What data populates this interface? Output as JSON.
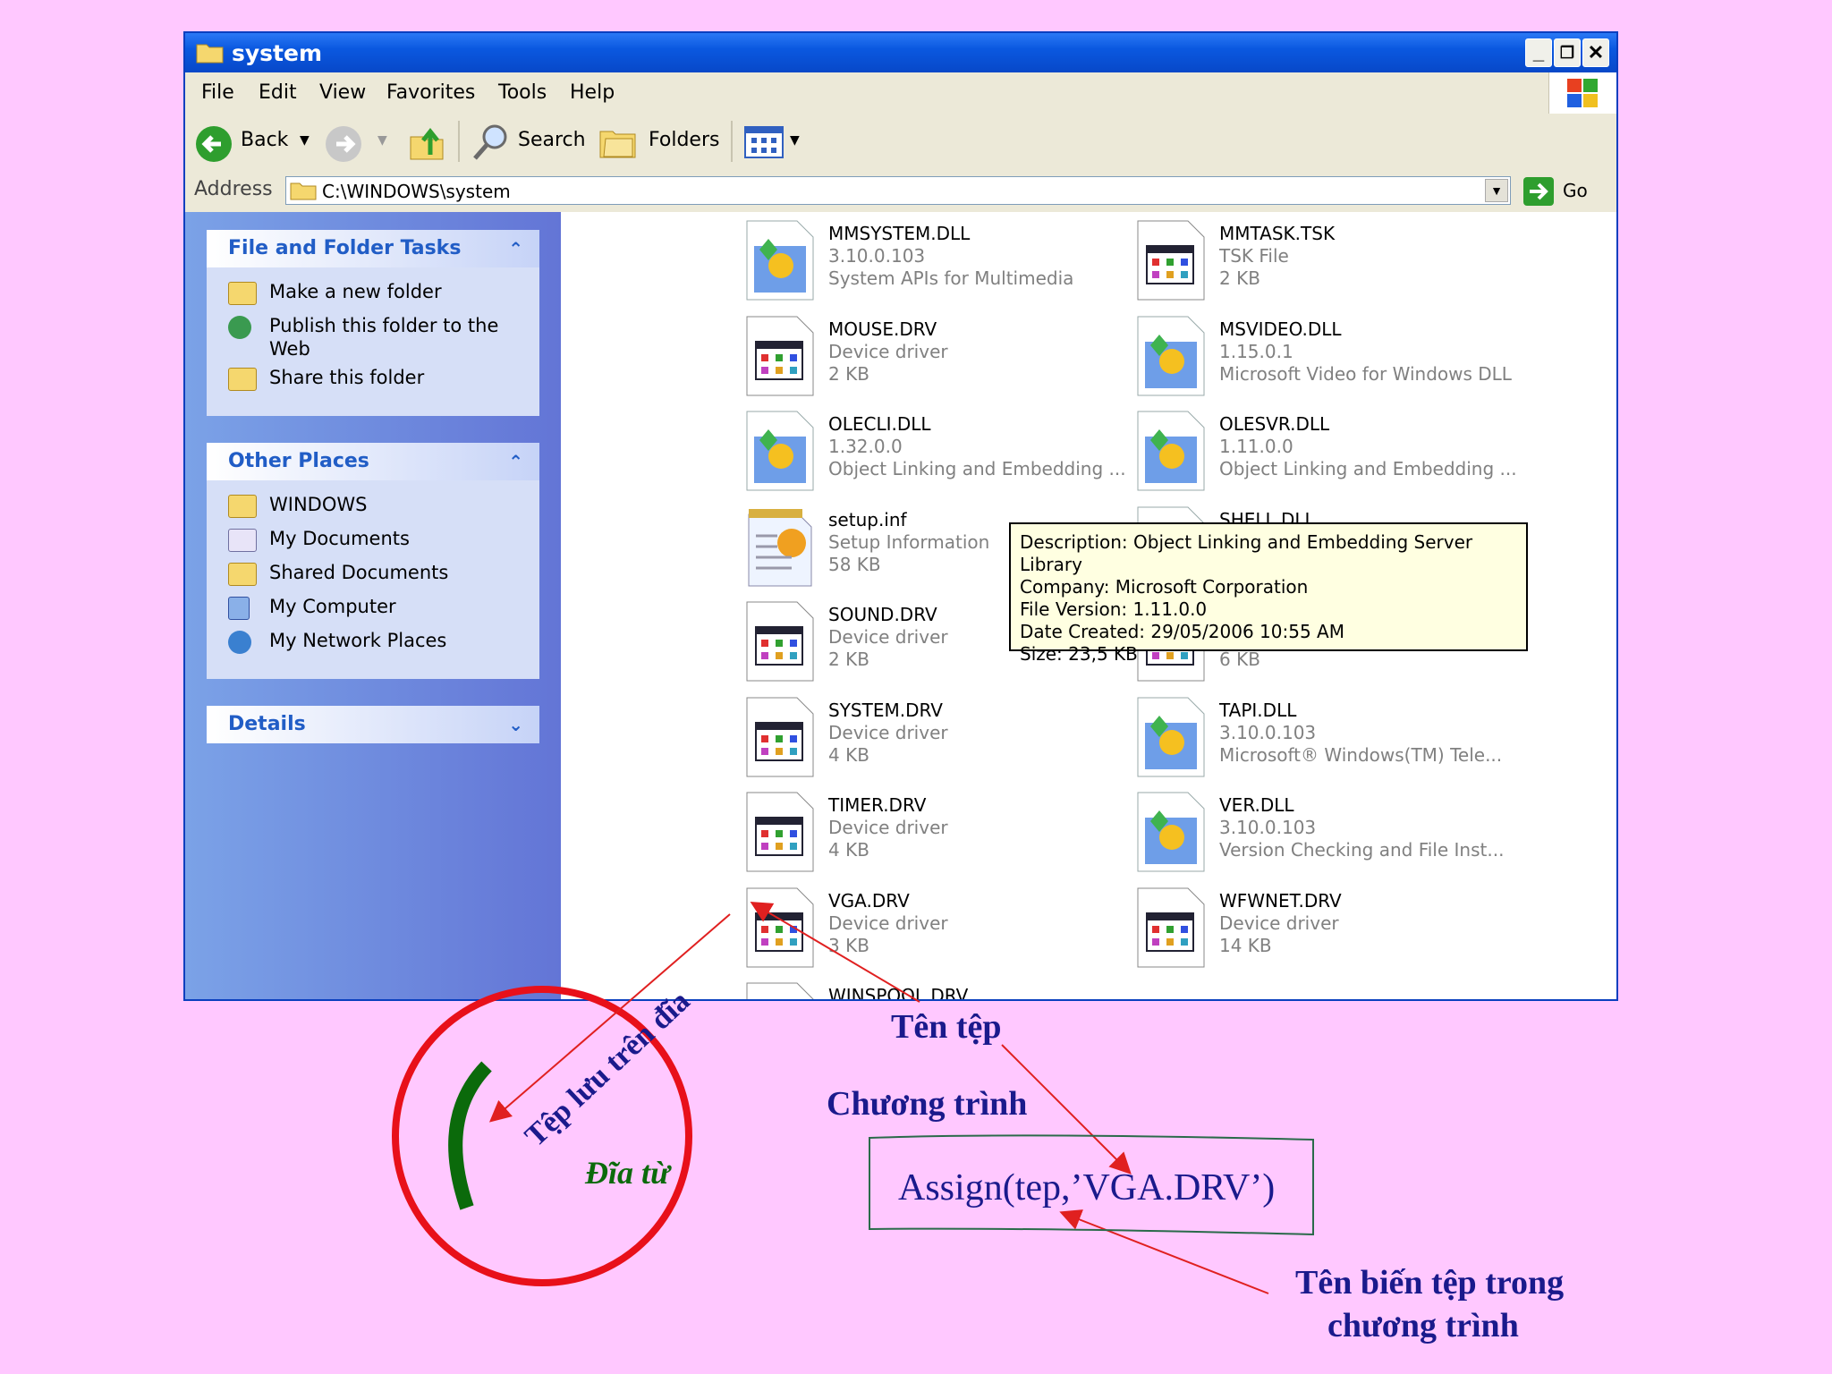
{
  "window": {
    "title": "system",
    "menu": [
      "File",
      "Edit",
      "View",
      "Favorites",
      "Tools",
      "Help"
    ],
    "toolbar": {
      "back": "Back",
      "search": "Search",
      "folders": "Folders"
    },
    "address": {
      "label": "Address",
      "value": "C:\\WINDOWS\\system",
      "go": "Go"
    }
  },
  "leftpane": {
    "tasks": {
      "title": "File and Folder Tasks",
      "items": [
        "Make a new folder",
        "Publish this folder to the Web",
        "Share this folder"
      ]
    },
    "places": {
      "title": "Other Places",
      "items": [
        "WINDOWS",
        "My Documents",
        "Shared Documents",
        "My Computer",
        "My Network Places"
      ]
    },
    "details": {
      "title": "Details"
    }
  },
  "files": [
    {
      "name": "MMSYSTEM.DLL",
      "l2": "3.10.0.103",
      "l3": "System APIs for Multimedia",
      "icon": "dll-icon"
    },
    {
      "name": "MMTASK.TSK",
      "l2": "TSK File",
      "l3": "2 KB",
      "icon": "driver-icon"
    },
    {
      "name": "MOUSE.DRV",
      "l2": "Device driver",
      "l3": "2 KB",
      "icon": "driver-icon"
    },
    {
      "name": "MSVIDEO.DLL",
      "l2": "1.15.0.1",
      "l3": "Microsoft Video for Windows DLL",
      "icon": "dll-icon"
    },
    {
      "name": "OLECLI.DLL",
      "l2": "1.32.0.0",
      "l3": "Object Linking and Embedding ...",
      "icon": "dll-icon"
    },
    {
      "name": "OLESVR.DLL",
      "l2": "1.11.0.0",
      "l3": "Object Linking and Embedding ...",
      "icon": "dll-icon"
    },
    {
      "name": "setup.inf",
      "l2": "Setup Information",
      "l3": "58 KB",
      "icon": "inf-icon"
    },
    {
      "name": "SHELL.DLL",
      "l2": "",
      "l3": "",
      "icon": "dll-icon"
    },
    {
      "name": "SOUND.DRV",
      "l2": "Device driver",
      "l3": "2 KB",
      "icon": "driver-icon"
    },
    {
      "name": "",
      "l2": "",
      "l3": "6 KB",
      "icon": "driver-icon"
    },
    {
      "name": "SYSTEM.DRV",
      "l2": "Device driver",
      "l3": "4 KB",
      "icon": "driver-icon"
    },
    {
      "name": "TAPI.DLL",
      "l2": "3.10.0.103",
      "l3": "Microsoft® Windows(TM) Tele...",
      "icon": "dll-icon"
    },
    {
      "name": "TIMER.DRV",
      "l2": "Device driver",
      "l3": "4 KB",
      "icon": "driver-icon"
    },
    {
      "name": "VER.DLL",
      "l2": "3.10.0.103",
      "l3": "Version Checking and File Inst...",
      "icon": "dll-icon"
    },
    {
      "name": "VGA.DRV",
      "l2": "Device driver",
      "l3": "3 KB",
      "icon": "driver-icon"
    },
    {
      "name": "WFWNET.DRV",
      "l2": "Device driver",
      "l3": "14 KB",
      "icon": "driver-icon"
    },
    {
      "name": "WINSPOOL.DRV",
      "l2": "",
      "l3": "",
      "icon": "driver-icon"
    }
  ],
  "tooltip": [
    "Description: Object Linking and Embedding Server Library",
    "Company: Microsoft Corporation",
    "File Version: 1.11.0.0",
    "Date Created: 29/05/2006 10:55 AM",
    "Size: 23,5 KB"
  ],
  "annotations": {
    "disk_label": "Đĩa từ",
    "disk_file": "Tệp lưu trên đĩa",
    "ten_tep": "Tên tệp",
    "chuong_trinh": "Chương trình",
    "assign": "Assign(tep,’VGA.DRV’)",
    "ten_bien_1": "Tên biến tệp trong",
    "ten_bien_2": "chương trình"
  },
  "colors": {
    "background": "#ffc8ff",
    "annotation_text": "#1a1a8c",
    "arrow": "#e02020",
    "disk_circle": "#e8101a",
    "disk_arc": "#0b6a0b"
  }
}
